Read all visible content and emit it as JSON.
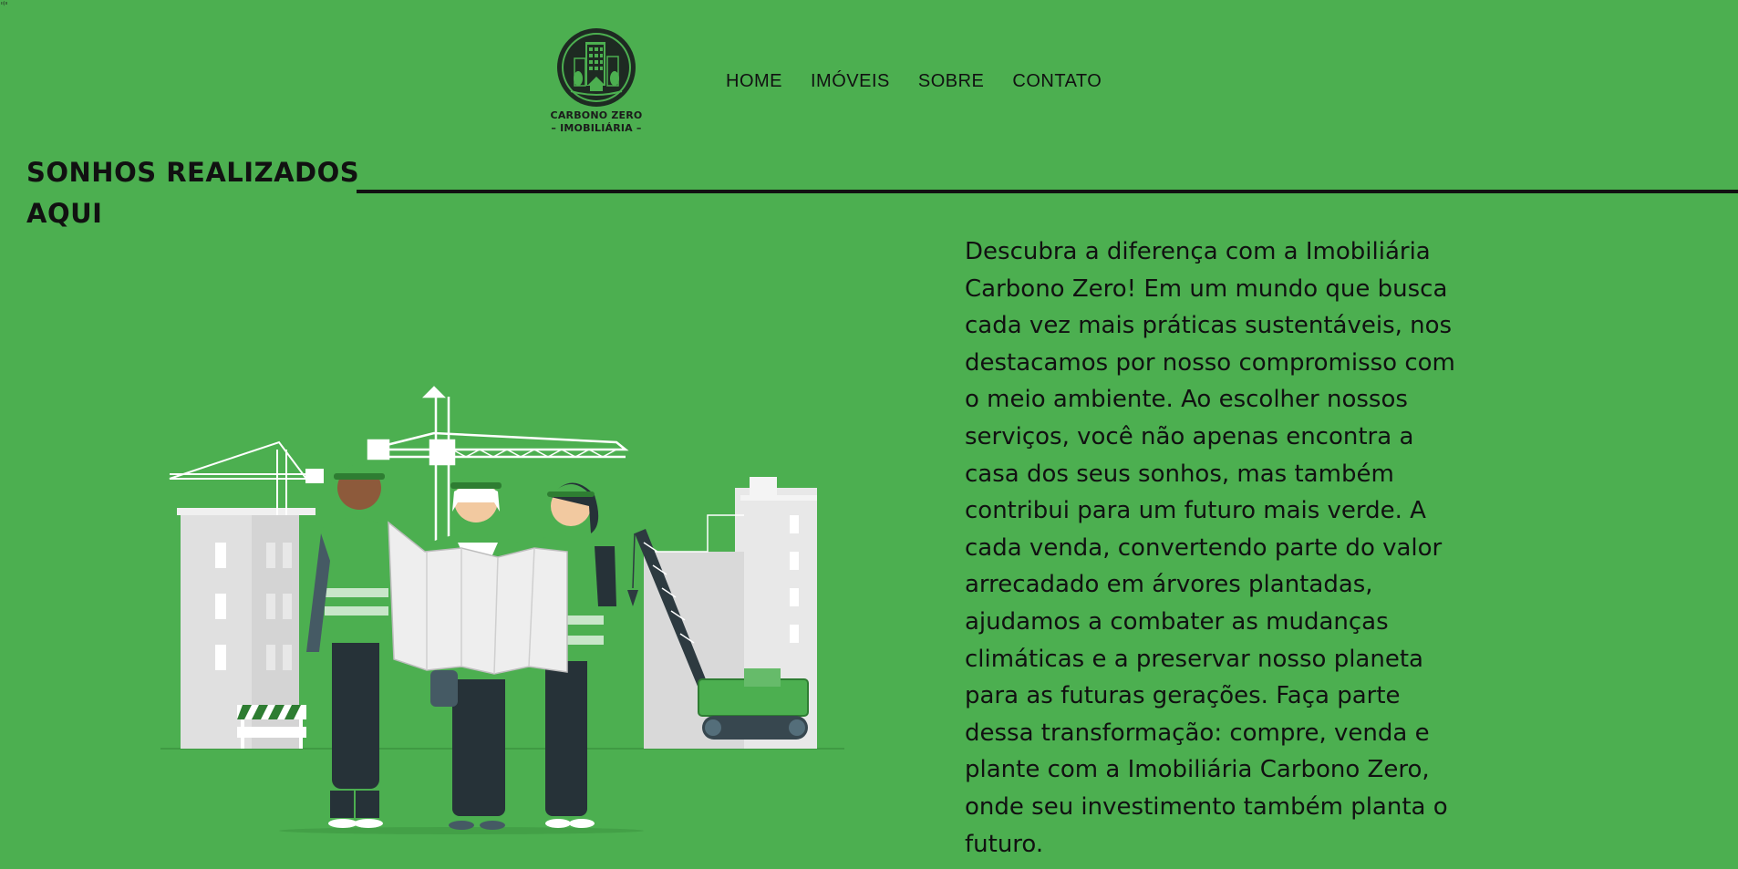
{
  "corner_mark": "ıı|ıı",
  "logo": {
    "line1": "CARBONO ZERO",
    "line2": "– IMOBILIÁRIA –"
  },
  "nav": {
    "items": [
      {
        "label": "HOME"
      },
      {
        "label": "IMÓVEIS"
      },
      {
        "label": "SOBRE"
      },
      {
        "label": "CONTATO"
      }
    ]
  },
  "hero": {
    "title": "SONHOS REALIZADOS AQUI",
    "description": "Descubra a diferença com a Imobiliária Carbono Zero! Em um mundo que busca cada vez mais práticas sustentáveis, nos destacamos por nosso compromisso com o meio ambiente. Ao escolher nossos serviços, você não apenas encontra a casa dos seus sonhos, mas também contribui para um futuro mais verde. A cada venda, convertendo parte do valor arrecadado em árvores plantadas, ajudamos a combater as mudanças climáticas e a preservar nosso planeta para as futuras gerações. Faça parte dessa transformação: compre, venda e plante com a Imobiliária Carbono Zero, onde seu investimento também planta o futuro."
  },
  "colors": {
    "background": "#4caf50",
    "text": "#111111",
    "accent_dark": "#263238"
  },
  "icons": {
    "logo": "building-leaf-logo-icon",
    "illustration": "construction-workers-illustration"
  }
}
